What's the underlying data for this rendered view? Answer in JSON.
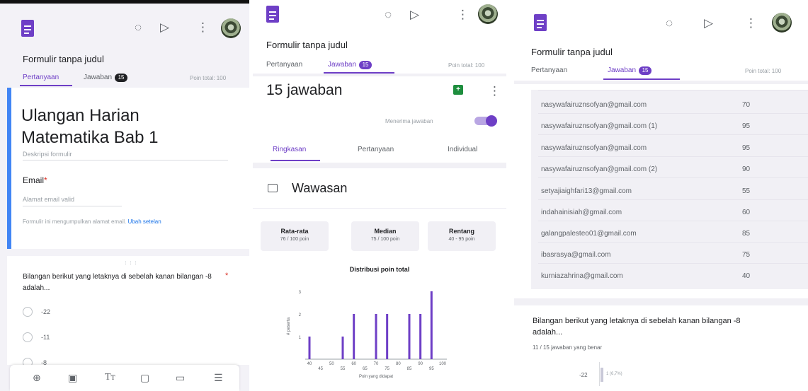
{
  "form_title": "Formulir tanpa judul",
  "tabs": {
    "questions": "Pertanyaan",
    "responses": "Jawaban",
    "count_badge": "15",
    "total_points": "Poin total: 100"
  },
  "panel1": {
    "form_heading": "Ulangan Harian Matematika Bab 1",
    "description_placeholder": "Deskripsi formulir",
    "email_label": "Email",
    "required_mark": "*",
    "email_placeholder": "Alamat email valid",
    "email_note": "Formulir ini mengumpulkan alamat email.",
    "email_note_link": "Ubah setelan",
    "drag_handle": "⋮⋮⋮",
    "question": "Bilangan berikut yang letaknya di sebelah kanan bilangan -8 adalah...",
    "options": [
      "-22",
      "-11",
      "-8"
    ]
  },
  "panel2": {
    "response_count": "15 jawaban",
    "accepting": "Menerima jawaban",
    "subtabs": [
      "Ringkasan",
      "Pertanyaan",
      "Individual"
    ],
    "insights_title": "Wawasan",
    "stats": [
      {
        "label": "Rata-rata",
        "value": "76 / 100 poin"
      },
      {
        "label": "Median",
        "value": "75 / 100 poin"
      },
      {
        "label": "Rentang",
        "value": "40 - 95 poin"
      }
    ],
    "chart_title": "Distribusi poin total"
  },
  "panel3": {
    "emails": [
      {
        "email": "nasywafairuznsofyan@gmail.com",
        "score": "70"
      },
      {
        "email": "nasywafairuznsofyan@gmail.com (1)",
        "score": "95"
      },
      {
        "email": "nasywafairuznsofyan@gmail.com",
        "score": "95"
      },
      {
        "email": "nasywafairuznsofyan@gmail.com (2)",
        "score": "90"
      },
      {
        "email": "setyajiaighfari13@gmail.com",
        "score": "55"
      },
      {
        "email": "indahainisiah@gmail.com",
        "score": "60"
      },
      {
        "email": "galangpalesteo01@gmail.com",
        "score": "85"
      },
      {
        "email": "ibasrasya@gmail.com",
        "score": "75"
      },
      {
        "email": "kurniazahrina@gmail.com",
        "score": "40"
      }
    ],
    "question": "Bilangan berikut yang letaknya di sebelah kanan bilangan -8 adalah...",
    "correct_summary": "11 / 15 jawaban yang benar",
    "option_label": "-22",
    "option_bar_text": "1 (6,7%)"
  },
  "colors": {
    "accent": "#6e3fc6",
    "blue_edge": "#4285f4",
    "sheets_green": "#1e8e3e"
  },
  "chart_data": {
    "type": "bar",
    "title": "Distribusi poin total",
    "xlabel": "Poin yang didapat",
    "ylabel": "# peserta",
    "categories": [
      "40",
      "45",
      "50",
      "55",
      "60",
      "65",
      "70",
      "75",
      "80",
      "85",
      "90",
      "95",
      "100"
    ],
    "values": [
      1,
      0,
      0,
      1,
      2,
      0,
      2,
      2,
      0,
      2,
      2,
      3,
      0
    ],
    "ylim": [
      0,
      3
    ]
  }
}
